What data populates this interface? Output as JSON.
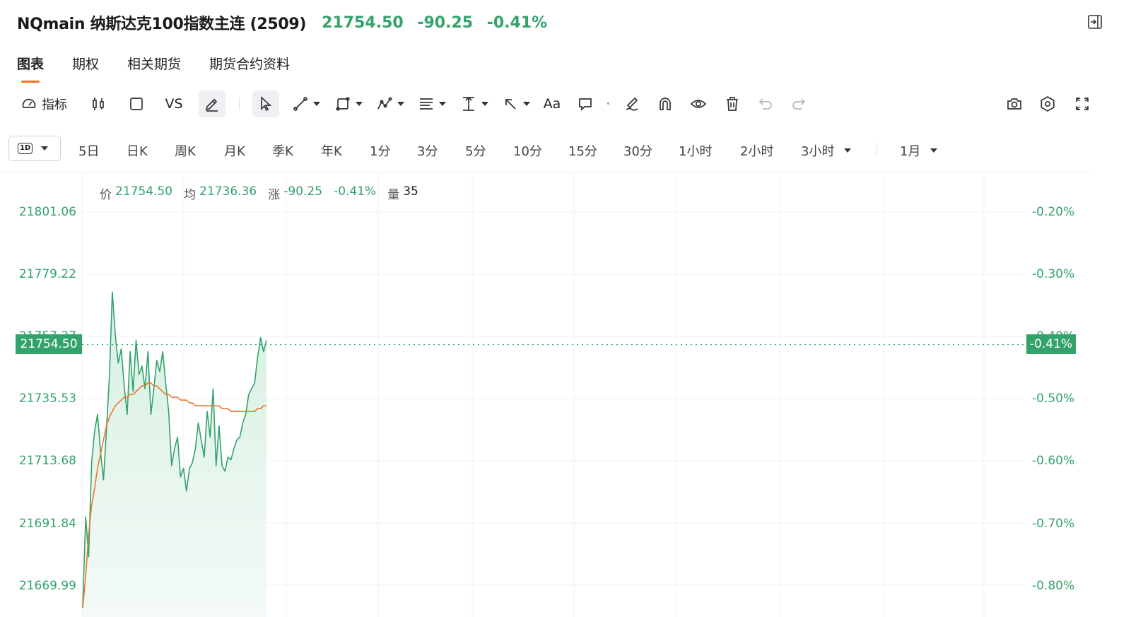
{
  "header": {
    "title": "NQmain 纳斯达克100指数主连 (2509)",
    "price": "21754.50",
    "change": "-90.25",
    "change_pct": "-0.41%",
    "up_color": "#33a36b"
  },
  "tabs": [
    {
      "label": "图表",
      "active": true
    },
    {
      "label": "期权",
      "active": false
    },
    {
      "label": "相关期货",
      "active": false
    },
    {
      "label": "期货合约资料",
      "active": false
    }
  ],
  "toolbar": {
    "indicator_label": "指标",
    "compare_label": "VS",
    "text_label": "Aa",
    "icons": [
      "gauge-icon",
      "candlestick-icon",
      "square-icon",
      "pencil-icon",
      "cursor-icon",
      "line-tool-icon",
      "shape-tool-icon",
      "pattern-tool-icon",
      "fib-tool-icon",
      "measure-tool-icon",
      "arrow-tool-icon",
      "comment-icon",
      "erase-draw-icon",
      "magnet-icon",
      "eye-icon",
      "trash-icon",
      "undo-icon",
      "redo-icon",
      "camera-icon",
      "settings-icon",
      "fullscreen-icon"
    ]
  },
  "periods": {
    "selected_badge": "1D",
    "items": [
      "5日",
      "日K",
      "周K",
      "月K",
      "季K",
      "年K",
      "1分",
      "3分",
      "5分",
      "10分",
      "15分",
      "30分",
      "1小时",
      "2小时",
      "3小时"
    ],
    "range": "1月"
  },
  "legend": {
    "price_label": "价",
    "price": "21754.50",
    "avg_label": "均",
    "avg": "21736.36",
    "change_label": "涨",
    "change": "-90.25",
    "change_pct": "-0.41%",
    "vol_label": "量",
    "vol": "35"
  },
  "chart_data": {
    "type": "area",
    "title": "",
    "y_ticks_left": [
      "21801.06",
      "21779.22",
      "21757.37",
      "21735.53",
      "21713.68",
      "21691.84",
      "21669.99"
    ],
    "y_ticks_right": [
      "-0.20%",
      "-0.30%",
      "-0.40%",
      "-0.50%",
      "-0.60%",
      "-0.70%",
      "-0.80%"
    ],
    "ylim": [
      21669.99,
      21801.06
    ],
    "current_price_label": "21754.50",
    "current_pct_label": "-0.41%",
    "current_price": 21754.5,
    "colors": {
      "price": "#33a36b",
      "average": "#e8782f",
      "area": "#e3f3ea"
    },
    "series": [
      {
        "name": "价",
        "values": [
          21662,
          21694,
          21680,
          21713,
          21724,
          21730,
          21717,
          21707,
          21724,
          21743,
          21773,
          21758,
          21748,
          21753,
          21740,
          21730,
          21752,
          21738,
          21756,
          21744,
          21747,
          21739,
          21752,
          21730,
          21739,
          21749,
          21745,
          21752,
          21741,
          21731,
          21712,
          21718,
          21722,
          21708,
          21711,
          21703,
          21711,
          21713,
          21718,
          21727,
          21721,
          21715,
          21731,
          21722,
          21739,
          21712,
          21726,
          21712,
          21710,
          21715,
          21714,
          21718,
          21721,
          21722,
          21727,
          21730,
          21737,
          21739,
          21741,
          21750,
          21757,
          21752,
          21756
        ]
      },
      {
        "name": "均",
        "values": [
          21662,
          21673,
          21688,
          21698,
          21704,
          21711,
          21716,
          21721,
          21726,
          21729,
          21731,
          21733,
          21734,
          21735,
          21736,
          21736,
          21737,
          21737,
          21738,
          21739,
          21740,
          21740,
          21741,
          21741,
          21740,
          21740,
          21739,
          21738,
          21737,
          21737,
          21736,
          21736,
          21736,
          21735,
          21735,
          21735,
          21734,
          21734,
          21733,
          21733,
          21733,
          21733,
          21733,
          21733,
          21733,
          21733,
          21733,
          21732,
          21732,
          21732,
          21731,
          21731,
          21731,
          21731,
          21731,
          21731,
          21731,
          21731,
          21731,
          21732,
          21732,
          21733,
          21733
        ]
      }
    ]
  }
}
